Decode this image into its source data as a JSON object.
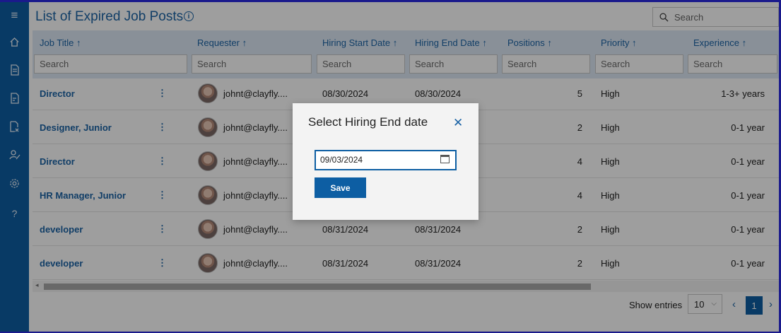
{
  "page": {
    "title": "List of Expired Job Posts",
    "search_placeholder": "Search"
  },
  "sidebar": {
    "icons": [
      "menu-icon",
      "home-icon",
      "document-icon",
      "report-icon",
      "document-remove-icon",
      "user-edit-icon",
      "gear-icon",
      "help-icon"
    ]
  },
  "table": {
    "columns": [
      {
        "label": "Job Title ↑",
        "filter": "Search"
      },
      {
        "label": "Requester ↑",
        "filter": "Search"
      },
      {
        "label": "Hiring Start Date ↑",
        "filter": "Search"
      },
      {
        "label": "Hiring End Date ↑",
        "filter": "Search"
      },
      {
        "label": "Positions ↑",
        "filter": "Search"
      },
      {
        "label": "Priority ↑",
        "filter": "Search"
      },
      {
        "label": "Experience ↑",
        "filter": "Search"
      }
    ],
    "rows": [
      {
        "title": "Director",
        "requester": "johnt@clayfly....",
        "start": "08/30/2024",
        "end": "08/30/2024",
        "positions": "5",
        "priority": "High",
        "experience": "1-3+ years"
      },
      {
        "title": "Designer, Junior",
        "requester": "johnt@clayfly....",
        "start": "",
        "end": "",
        "positions": "2",
        "priority": "High",
        "experience": "0-1 year"
      },
      {
        "title": "Director",
        "requester": "johnt@clayfly....",
        "start": "",
        "end": "",
        "positions": "4",
        "priority": "High",
        "experience": "0-1 year"
      },
      {
        "title": "HR Manager, Junior",
        "requester": "johnt@clayfly....",
        "start": "",
        "end": "",
        "positions": "4",
        "priority": "High",
        "experience": "0-1 year"
      },
      {
        "title": "developer",
        "requester": "johnt@clayfly....",
        "start": "08/31/2024",
        "end": "08/31/2024",
        "positions": "2",
        "priority": "High",
        "experience": "0-1 year"
      },
      {
        "title": "developer",
        "requester": "johnt@clayfly....",
        "start": "08/31/2024",
        "end": "08/31/2024",
        "positions": "2",
        "priority": "High",
        "experience": "0-1 year"
      }
    ]
  },
  "footer": {
    "show_entries_label": "Show entries",
    "entries_value": "10",
    "current_page": "1"
  },
  "dialog": {
    "title": "Select Hiring End date",
    "date_value": "09/03/2024",
    "save_label": "Save"
  },
  "colors": {
    "accent": "#0d5ea3",
    "link": "#1c64a6",
    "header_bg": "#dde9f6"
  }
}
